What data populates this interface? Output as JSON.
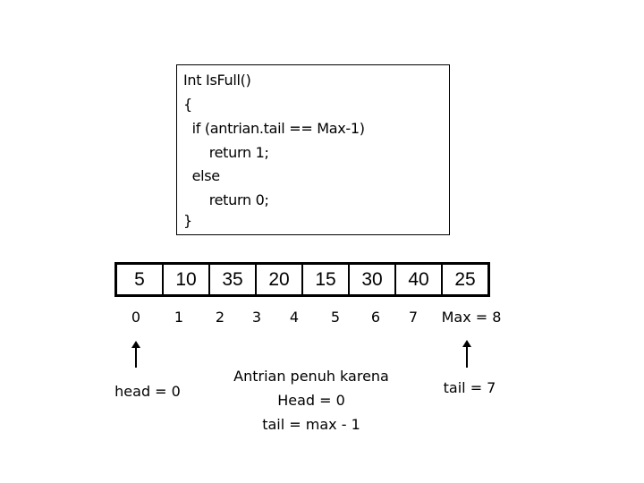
{
  "code": {
    "lines": [
      "Int IsFull()",
      "{",
      "  if (antrian.tail == Max-1)",
      "      return 1;",
      "  else",
      "      return 0;",
      "}"
    ]
  },
  "array": {
    "values": [
      "5",
      "10",
      "35",
      "20",
      "15",
      "30",
      "40",
      "25"
    ],
    "indices": [
      "0",
      "1",
      "2",
      "3",
      "4",
      "5",
      "6",
      "7"
    ],
    "max_label": "Max = 8"
  },
  "pointers": {
    "head_label": "head = 0",
    "tail_label": "tail = 7"
  },
  "note": {
    "lines": [
      "Antrian penuh karena",
      "Head = 0",
      "tail = max - 1"
    ]
  }
}
